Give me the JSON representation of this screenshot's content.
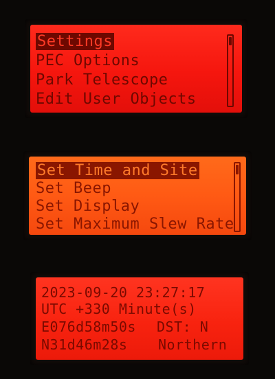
{
  "menu_panel": {
    "items": [
      {
        "label": "Settings",
        "selected": true
      },
      {
        "label": "PEC Options",
        "selected": false
      },
      {
        "label": "Park Telescope",
        "selected": false
      },
      {
        "label": "Edit User Objects",
        "selected": false
      }
    ]
  },
  "settings_panel": {
    "items": [
      {
        "label": "Set Time and Site",
        "selected": true
      },
      {
        "label": "Set Beep",
        "selected": false
      },
      {
        "label": "Set Display",
        "selected": false
      },
      {
        "label": "Set Maximum Slew Rate",
        "selected": false
      }
    ]
  },
  "status_panel": {
    "datetime": "2023-09-20 23:27:17",
    "utc_offset": "UTC +330 Minute(s)",
    "longitude": "E076d58m50s",
    "dst_label": "DST: N",
    "latitude": "N31d46m28s",
    "hemisphere": "Northern"
  },
  "colors": {
    "lcd_red": "#f5160e",
    "lcd_orange": "#ff5a14",
    "text_dark_red": "#6e0800"
  }
}
